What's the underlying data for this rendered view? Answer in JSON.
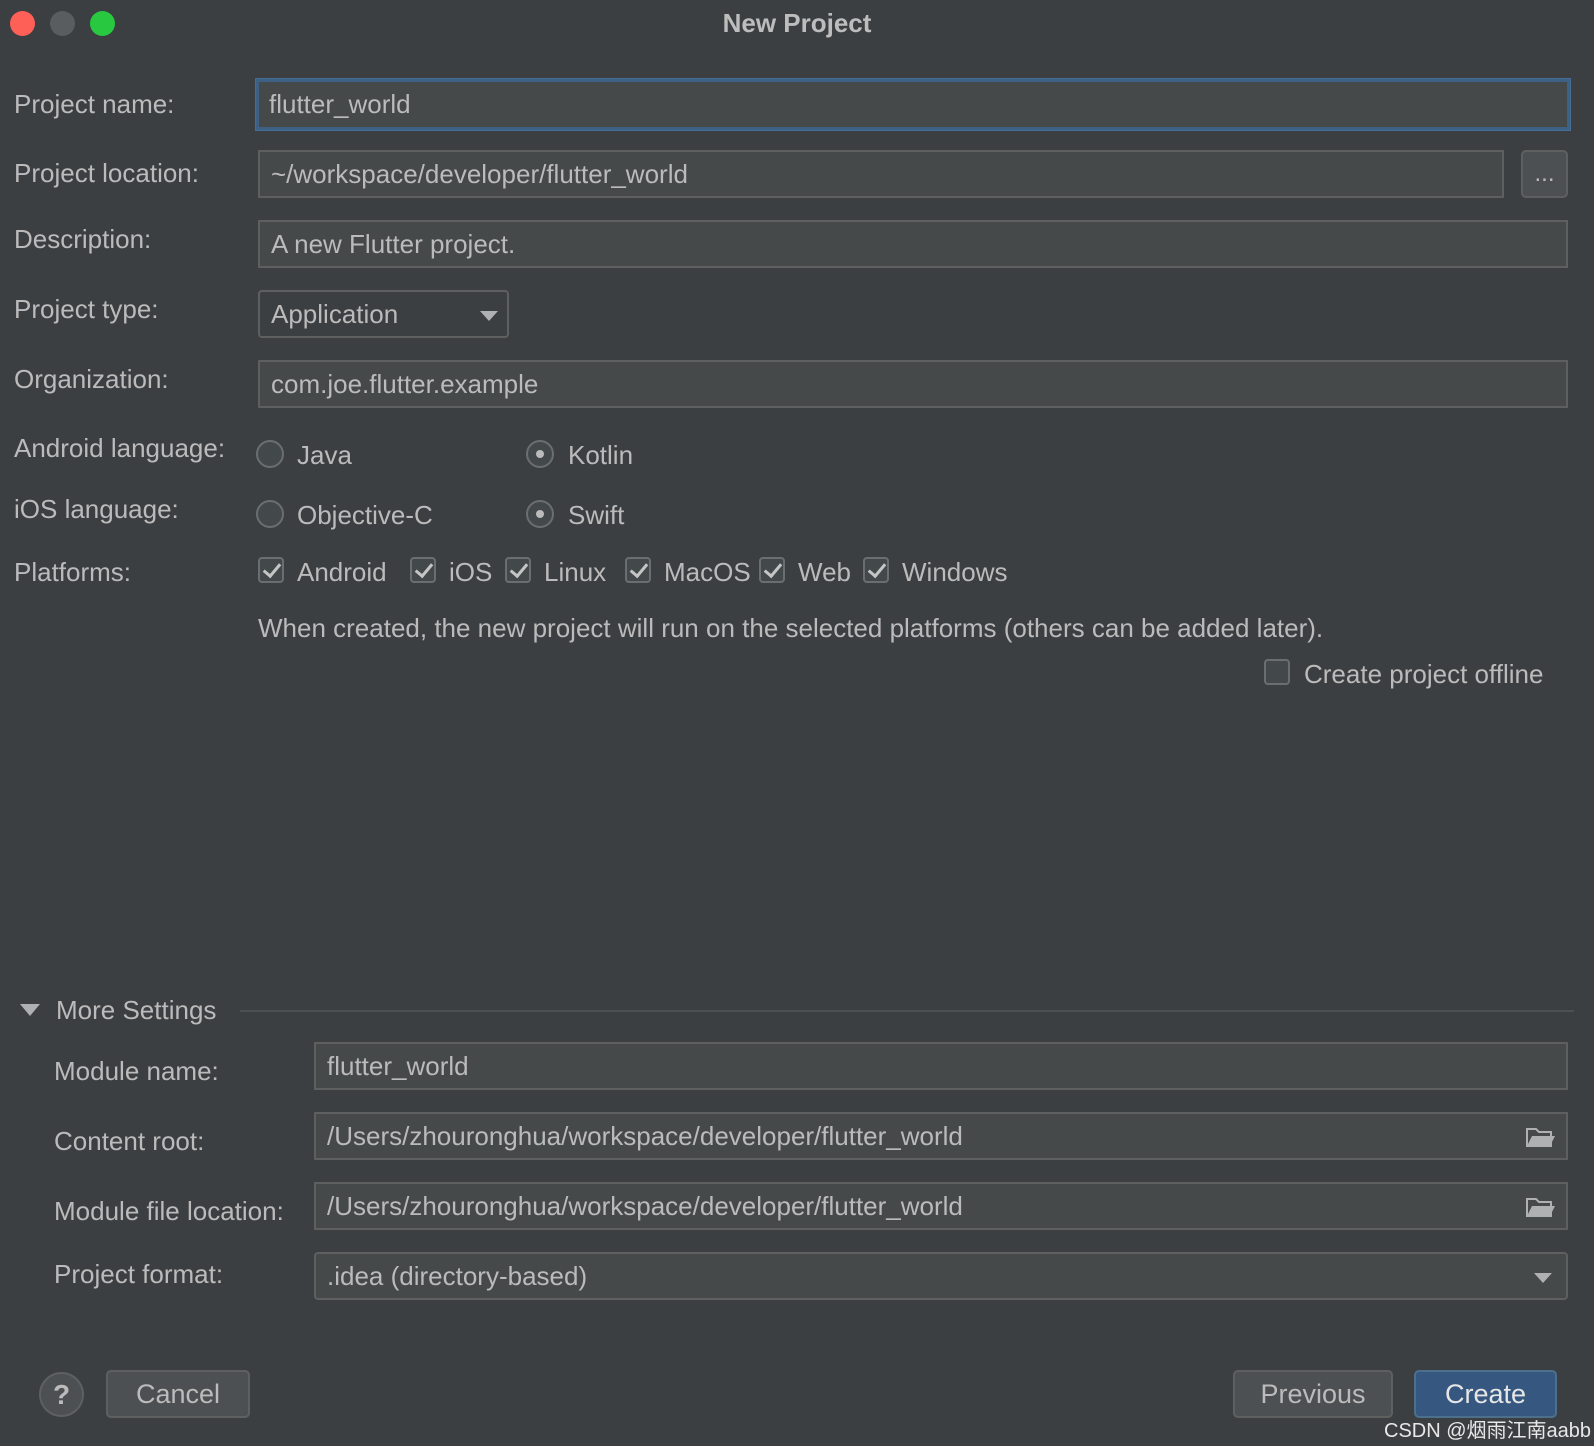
{
  "window": {
    "title": "New Project"
  },
  "form": {
    "project_name_label": "Project name:",
    "project_name_value": "flutter_world",
    "project_location_label": "Project location:",
    "project_location_value": "~/workspace/developer/flutter_world",
    "browse_label": "...",
    "description_label": "Description:",
    "description_value": "A new Flutter project.",
    "project_type_label": "Project type:",
    "project_type_value": "Application",
    "organization_label": "Organization:",
    "organization_value": "com.joe.flutter.example",
    "android_language_label": "Android language:",
    "android_options": [
      "Java",
      "Kotlin"
    ],
    "android_selected": "Kotlin",
    "ios_language_label": "iOS language:",
    "ios_options": [
      "Objective-C",
      "Swift"
    ],
    "ios_selected": "Swift",
    "platforms_label": "Platforms:",
    "platforms": [
      "Android",
      "iOS",
      "Linux",
      "MacOS",
      "Web",
      "Windows"
    ],
    "platforms_hint": "When created, the new project will run on the selected platforms (others can be added later).",
    "offline_label": "Create project offline",
    "offline_checked": false
  },
  "more_settings": {
    "header": "More Settings",
    "module_name_label": "Module name:",
    "module_name_value": "flutter_world",
    "content_root_label": "Content root:",
    "content_root_value": "/Users/zhouronghua/workspace/developer/flutter_world",
    "module_file_location_label": "Module file location:",
    "module_file_location_value": "/Users/zhouronghua/workspace/developer/flutter_world",
    "project_format_label": "Project format:",
    "project_format_value": ".idea (directory-based)"
  },
  "footer": {
    "help_label": "?",
    "cancel_label": "Cancel",
    "previous_label": "Previous",
    "create_label": "Create"
  },
  "watermark": "CSDN @烟雨江南aabb",
  "colors": {
    "background": "#3c3f41",
    "field": "#45494a",
    "focus_border": "#3d6185",
    "primary_button": "#365880"
  }
}
